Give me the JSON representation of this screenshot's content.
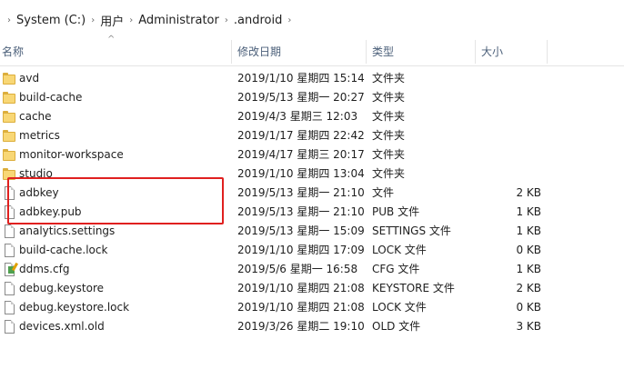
{
  "breadcrumb": [
    "System (C:)",
    "用户",
    "Administrator",
    ".android"
  ],
  "columns": {
    "name": "名称",
    "date": "修改日期",
    "type": "类型",
    "size": "大小"
  },
  "files": [
    {
      "name": "avd",
      "date": "2019/1/10 星期四 15:14",
      "type": "文件夹",
      "size": "",
      "icon": "folder-icon"
    },
    {
      "name": "build-cache",
      "date": "2019/5/13 星期一 20:27",
      "type": "文件夹",
      "size": "",
      "icon": "folder-icon"
    },
    {
      "name": "cache",
      "date": "2019/4/3 星期三 12:03",
      "type": "文件夹",
      "size": "",
      "icon": "folder-icon"
    },
    {
      "name": "metrics",
      "date": "2019/1/17 星期四 22:42",
      "type": "文件夹",
      "size": "",
      "icon": "folder-icon"
    },
    {
      "name": "monitor-workspace",
      "date": "2019/4/17 星期三 20:17",
      "type": "文件夹",
      "size": "",
      "icon": "folder-icon"
    },
    {
      "name": "studio",
      "date": "2019/1/10 星期四 13:04",
      "type": "文件夹",
      "size": "",
      "icon": "folder-icon"
    },
    {
      "name": "adbkey",
      "date": "2019/5/13 星期一 21:10",
      "type": "文件",
      "size": "2 KB",
      "icon": "file-icon"
    },
    {
      "name": "adbkey.pub",
      "date": "2019/5/13 星期一 21:10",
      "type": "PUB 文件",
      "size": "1 KB",
      "icon": "file-icon"
    },
    {
      "name": "analytics.settings",
      "date": "2019/5/13 星期一 15:09",
      "type": "SETTINGS 文件",
      "size": "1 KB",
      "icon": "file-icon"
    },
    {
      "name": "build-cache.lock",
      "date": "2019/1/10 星期四 17:09",
      "type": "LOCK 文件",
      "size": "0 KB",
      "icon": "file-icon"
    },
    {
      "name": "ddms.cfg",
      "date": "2019/5/6 星期一 16:58",
      "type": "CFG 文件",
      "size": "1 KB",
      "icon": "cfg-file-icon"
    },
    {
      "name": "debug.keystore",
      "date": "2019/1/10 星期四 21:08",
      "type": "KEYSTORE 文件",
      "size": "2 KB",
      "icon": "file-icon"
    },
    {
      "name": "debug.keystore.lock",
      "date": "2019/1/10 星期四 21:08",
      "type": "LOCK 文件",
      "size": "0 KB",
      "icon": "file-icon"
    },
    {
      "name": "devices.xml.old",
      "date": "2019/3/26 星期二 19:10",
      "type": "OLD 文件",
      "size": "3 KB",
      "icon": "file-icon"
    }
  ],
  "highlight": {
    "color": "#e0201f",
    "covers": [
      "adbkey",
      "adbkey.pub"
    ]
  }
}
